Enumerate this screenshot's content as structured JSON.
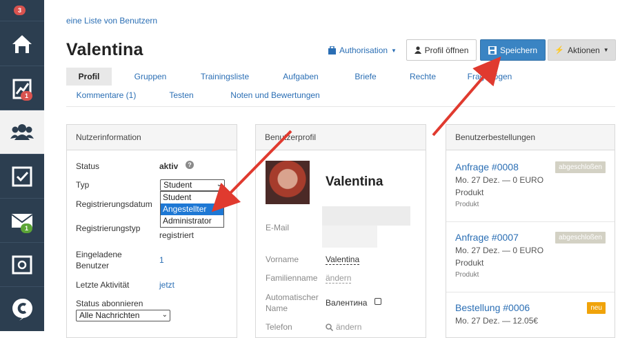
{
  "sidebar": {
    "badges": {
      "top": "3",
      "reports": "1",
      "messages": "1"
    },
    "icons": [
      "home-icon",
      "chart-icon",
      "users-icon",
      "tasks-icon",
      "mail-icon",
      "safe-icon",
      "logo-icon"
    ]
  },
  "breadcrumb": "eine Liste von Benutzern",
  "title": "Valentina",
  "header": {
    "authorisation": "Authorisation",
    "open_profile": "Profil öffnen",
    "save": "Speichern",
    "actions": "Aktionen"
  },
  "tabs_row1": [
    "Profil",
    "Gruppen",
    "Trainingsliste",
    "Aufgaben",
    "Briefe",
    "Rechte",
    "Fragebögen"
  ],
  "tabs_row2": [
    "Kommentare (1)",
    "Testen",
    "Noten und Bewertungen"
  ],
  "user_info": {
    "heading": "Nutzerinformation",
    "status_label": "Status",
    "status_value": "aktiv",
    "type_label": "Typ",
    "type_selected": "Student",
    "type_options": [
      "Student",
      "Angestellter",
      "Administrator"
    ],
    "reg_date_label": "Registrierungsdatum",
    "reg_type_label": "Registrierungstyp",
    "reg_type_value": "registriert",
    "invited_label": "Eingeladene Benutzer",
    "invited_value": "1",
    "last_activity_label": "Letzte Aktivität",
    "last_activity_value": "jetzt",
    "subscribe_label": "Status abonnieren",
    "subscribe_value": "Alle Nachrichten"
  },
  "profile": {
    "heading": "Benutzerprofil",
    "name": "Valentina",
    "email_label": "E-Mail",
    "firstname_label": "Vorname",
    "firstname_value": "Valentina",
    "lastname_label": "Familienname",
    "lastname_value": "ändern",
    "autoname_label": "Automatischer Name",
    "autoname_value": "Валентина",
    "phone_label": "Telefon",
    "phone_value": "ändern"
  },
  "orders": {
    "heading": "Benutzerbestellungen",
    "items": [
      {
        "title": "Anfrage #0008",
        "line": "Mo. 27 Dez. — 0 EURO",
        "product": "Produkt",
        "sub": "Produkt",
        "status": "abgeschloßen",
        "status_color": "#d3d1c4"
      },
      {
        "title": "Anfrage #0007",
        "line": "Mo. 27 Dez. — 0 EURO",
        "product": "Produkt",
        "sub": "Produkt",
        "status": "abgeschloßen",
        "status_color": "#d3d1c4"
      },
      {
        "title": "Bestellung #0006",
        "line": "Mo. 27 Dez. — 12.05€",
        "product": "",
        "sub": "",
        "status": "neu",
        "status_color": "#f0a30a"
      }
    ]
  },
  "colors": {
    "sidebar": "#2c3e50",
    "primary": "#3a84c3",
    "link": "#2a6eb4",
    "arrow": "#e03a2f"
  }
}
